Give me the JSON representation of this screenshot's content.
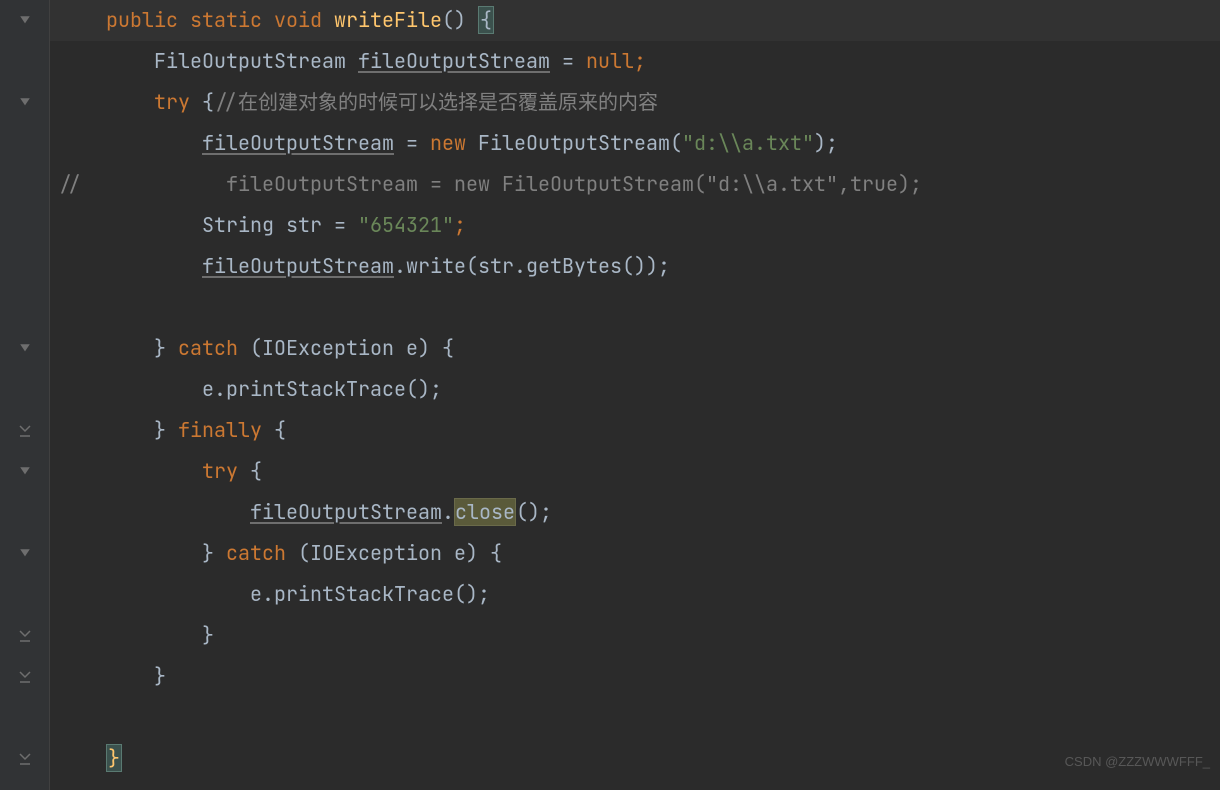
{
  "code": {
    "line1": {
      "pad": "    ",
      "public": "public",
      "static": "static",
      "void": "void",
      "method": "writeFile",
      "parens": "() ",
      "brace": "{"
    },
    "line2": {
      "pad": "        ",
      "type": "FileOutputStream ",
      "var": "fileOutputStream",
      "eq": " = ",
      "null": "null",
      "semi": ";"
    },
    "line3": {
      "pad": "        ",
      "try": "try",
      "brace": " {",
      "comment": "//在创建对象的时候可以选择是否覆盖原来的内容"
    },
    "line4": {
      "pad": "            ",
      "var": "fileOutputStream",
      "eq": " = ",
      "new": "new",
      "sp": " ",
      "type": "FileOutputStream(",
      "str": "\"d:\\\\a.txt\"",
      "close": ");"
    },
    "line5": {
      "prefix": "//",
      "pad": "            ",
      "rest": "fileOutputStream = new FileOutputStream(\"d:\\\\a.txt\",true);"
    },
    "line6": {
      "pad": "            ",
      "type": "String str = ",
      "str": "\"654321\"",
      "semi": ";"
    },
    "line7": {
      "pad": "            ",
      "var": "fileOutputStream",
      "rest": ".write(str.getBytes());"
    },
    "line8": {
      "pad": ""
    },
    "line9": {
      "pad": "        ",
      "close": "} ",
      "catch": "catch",
      "args": " (IOException e) {"
    },
    "line10": {
      "pad": "            ",
      "text": "e.printStackTrace();"
    },
    "line11": {
      "pad": "        ",
      "close": "} ",
      "finally": "finally",
      "brace": " {"
    },
    "line12": {
      "pad": "            ",
      "try": "try",
      "brace": " {"
    },
    "line13": {
      "pad": "                ",
      "var": "fileOutputStream",
      "dot": ".",
      "close_m": "close",
      "rest": "();"
    },
    "line14": {
      "pad": "            ",
      "close": "} ",
      "catch": "catch",
      "args": " (IOException e) {"
    },
    "line15": {
      "pad": "                ",
      "text": "e.printStackTrace();"
    },
    "line16": {
      "pad": "            ",
      "brace": "}"
    },
    "line17": {
      "pad": "        ",
      "brace": "}"
    },
    "line18": {
      "pad": ""
    },
    "line19": {
      "pad": "    ",
      "brace": "}"
    }
  },
  "watermark": "CSDN @ZZZWWWFFF_",
  "gutter_markers": [
    {
      "type": "fold",
      "row": 0
    },
    {
      "type": "fold",
      "row": 2
    },
    {
      "type": "fold",
      "row": 8
    },
    {
      "type": "method",
      "row": 10
    },
    {
      "type": "fold",
      "row": 11
    },
    {
      "type": "fold",
      "row": 13
    },
    {
      "type": "method",
      "row": 15
    },
    {
      "type": "method",
      "row": 16
    },
    {
      "type": "method",
      "row": 18
    }
  ]
}
